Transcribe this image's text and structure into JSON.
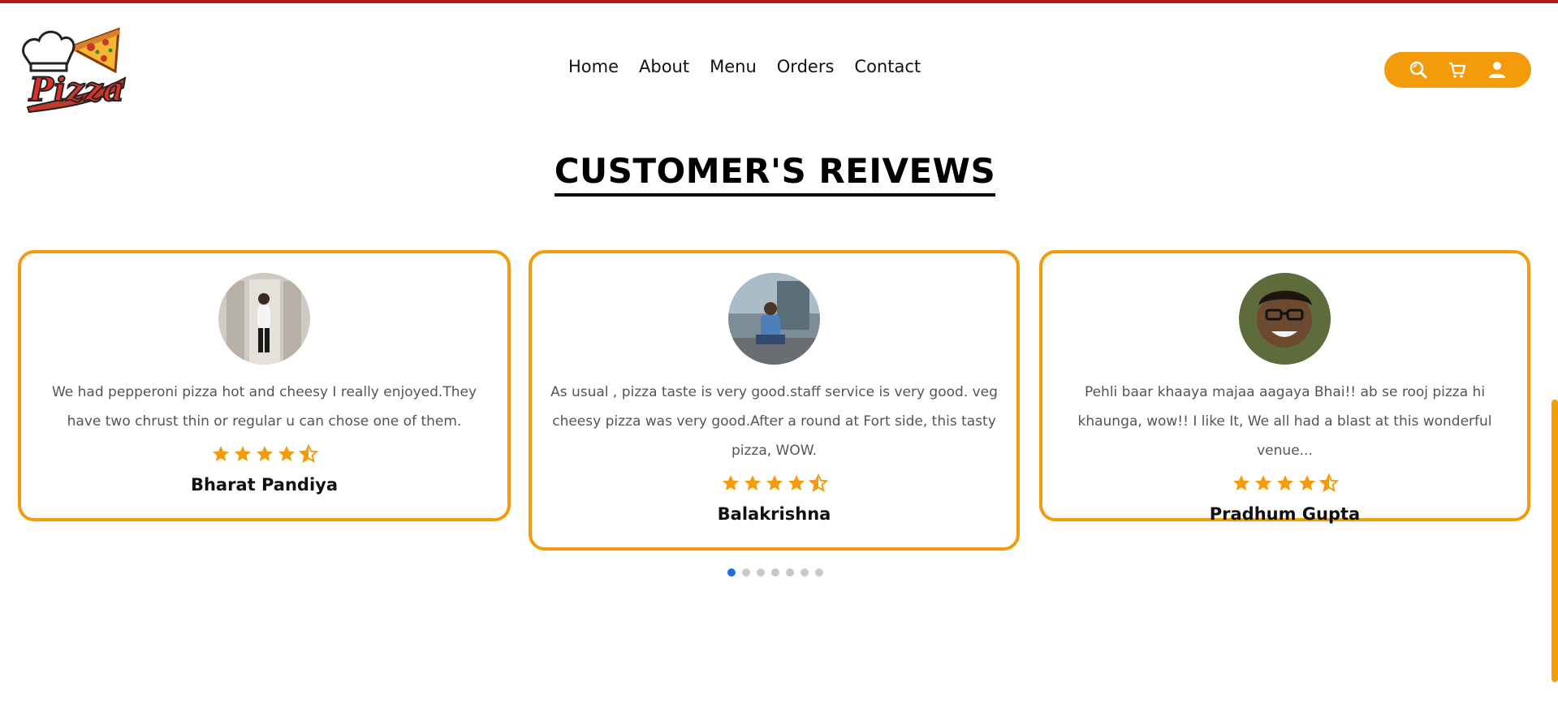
{
  "brand": {
    "logo_text": "Pizza",
    "accent_color": "#f49b0b",
    "top_strip_color": "#b31b1b"
  },
  "nav": {
    "items": [
      {
        "label": "Home"
      },
      {
        "label": "About"
      },
      {
        "label": "Menu"
      },
      {
        "label": "Orders"
      },
      {
        "label": "Contact"
      }
    ]
  },
  "header_icons": [
    "search-icon",
    "cart-icon",
    "user-icon"
  ],
  "section": {
    "title": "CUSTOMER'S REIVEWS"
  },
  "reviews": [
    {
      "text": "We had pepperoni pizza hot and cheesy I really enjoyed.They have two chrust thin or regular u can chose one of them.",
      "rating": 4.5,
      "name": "Bharat Pandiya"
    },
    {
      "text": "As usual , pizza taste is very good.staff service is very good. veg cheesy pizza was very good.After a round at Fort side, this tasty pizza, WOW.",
      "rating": 4.5,
      "name": "Balakrishna"
    },
    {
      "text": "Pehli baar khaaya majaa aagaya Bhai!! ab se rooj pizza hi khaunga, wow!! I like It, We all had a blast at this wonderful venue...",
      "rating": 4.5,
      "name": "Pradhum Gupta"
    }
  ],
  "carousel": {
    "total_slides": 7,
    "active_index": 0,
    "active_color": "#1b6fe0"
  }
}
